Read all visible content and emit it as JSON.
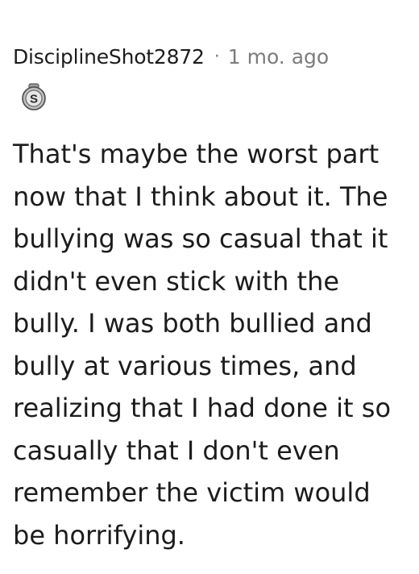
{
  "comment": {
    "username": "DisciplineShot2872",
    "separator": "·",
    "timestamp": "1 mo. ago",
    "flair_icon": "s-coin-badge-icon",
    "flair_letter": "S",
    "body_lines": [
      "That's maybe the worst part",
      "now that I think about it. The",
      "bullying was so casual that it",
      "didn't even stick with the",
      "bully. I was both bullied and",
      "bully at various times, and",
      "realizing that I had done it so",
      "casually that I don't even",
      "remember the victim would",
      "be horrifying."
    ]
  }
}
